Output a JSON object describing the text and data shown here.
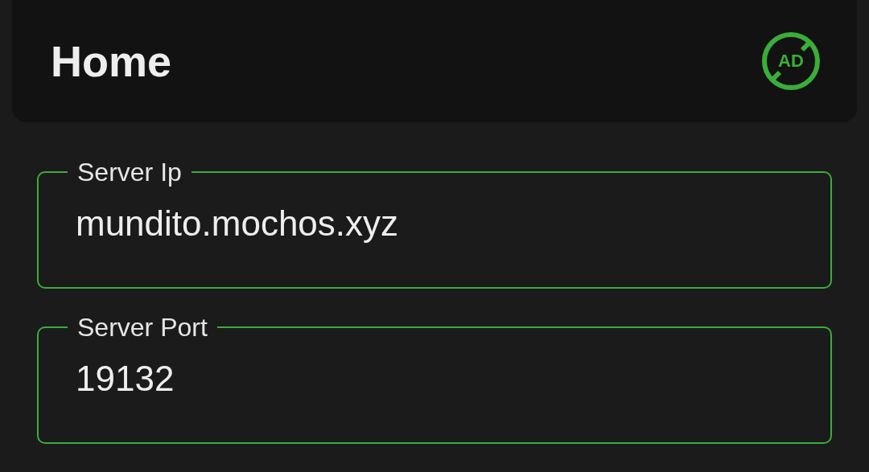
{
  "header": {
    "title": "Home",
    "ad_button": {
      "label": "AD"
    }
  },
  "fields": [
    {
      "label": "Server Ip",
      "value": "mundito.mochos.xyz"
    },
    {
      "label": "Server Port",
      "value": "19132"
    }
  ]
}
